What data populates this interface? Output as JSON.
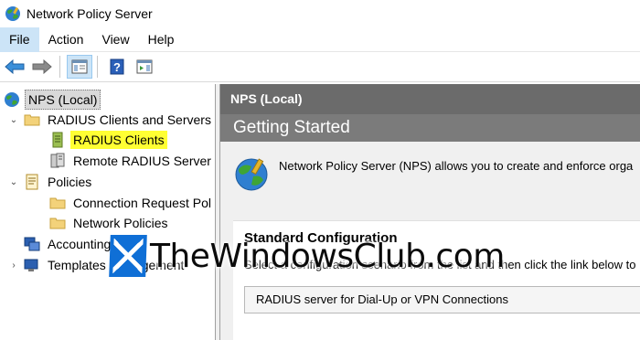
{
  "window": {
    "title": "Network Policy Server"
  },
  "menu": [
    {
      "label": "File",
      "active": true
    },
    {
      "label": "Action"
    },
    {
      "label": "View"
    },
    {
      "label": "Help"
    }
  ],
  "toolbar": {
    "buttons": [
      "back-arrow-icon",
      "forward-arrow-icon",
      "show-hide-console-tree-icon",
      "help-icon",
      "action-pane-icon"
    ]
  },
  "tree": {
    "root": "NPS (Local)",
    "radius_group": "RADIUS Clients and Servers",
    "radius_clients": "RADIUS Clients",
    "remote_radius": "Remote RADIUS Server G",
    "policies": "Policies",
    "connection_request": "Connection Request Pol",
    "network_policies": "Network Policies",
    "accounting": "Accounting",
    "templates": "Templates Management"
  },
  "content": {
    "header": "NPS (Local)",
    "getting_started": "Getting Started",
    "description": "Network Policy Server (NPS) allows you to create and enforce orga",
    "standard": {
      "title": "Standard Configuration",
      "description": "Select a configuration scenario from the list and then click the link below to",
      "selected_scenario": "RADIUS server for Dial-Up or VPN Connections"
    }
  },
  "watermark": {
    "text": "TheWindowsClub.com"
  },
  "colors": {
    "highlight": "#ffff33",
    "header_bg": "#6b6b6b",
    "menu_active": "#cce4f7"
  }
}
